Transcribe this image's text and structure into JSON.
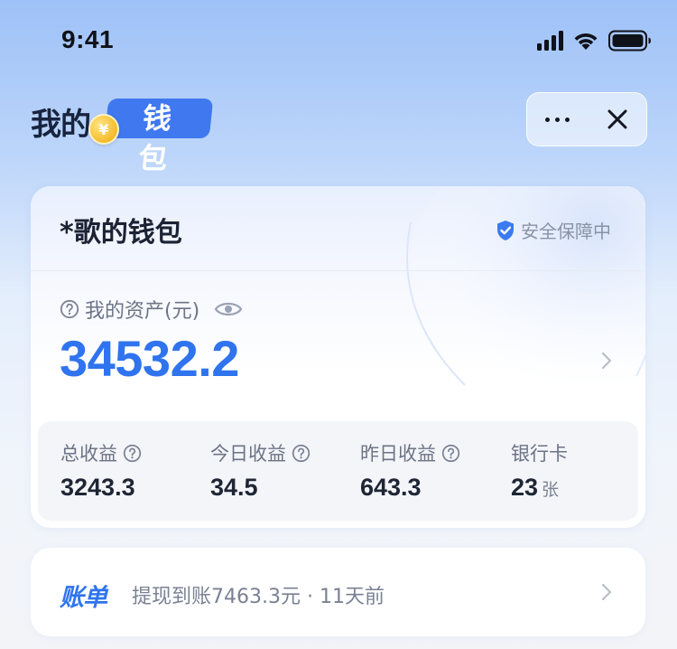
{
  "status_bar": {
    "time": "9:41"
  },
  "header": {
    "title_part1": "我的",
    "title_part2": "钱包",
    "coin_symbol": "¥",
    "more_icon": "more-dots-icon",
    "close_icon": "close-icon"
  },
  "wallet": {
    "name": "*歌的钱包",
    "security_text": "安全保障中",
    "asset_label": "我的资产(元)",
    "asset_value": "34532.2"
  },
  "stats": [
    {
      "label": "总收益",
      "value": "3243.3",
      "unit": ""
    },
    {
      "label": "今日收益",
      "value": "34.5",
      "unit": ""
    },
    {
      "label": "昨日收益",
      "value": "643.3",
      "unit": ""
    },
    {
      "label": "银行卡",
      "value": "23",
      "unit": "张"
    }
  ],
  "bill": {
    "tag": "账单",
    "text": "提现到账7463.3元 · 11天前"
  },
  "colors": {
    "accent": "#2f74ee",
    "title_pill": "#3f78ef",
    "coin": "#f8c43a"
  }
}
